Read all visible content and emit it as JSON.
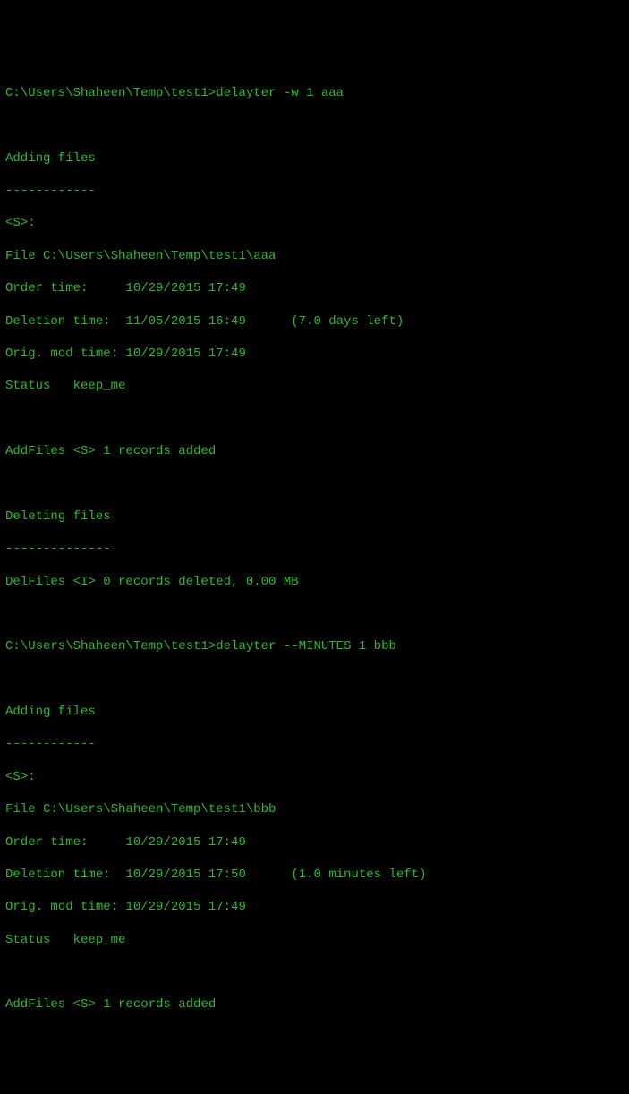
{
  "cmd1": {
    "prompt": "C:\\Users\\Shaheen\\Temp\\test1>",
    "command": "delayter -w 1 aaa"
  },
  "section1": {
    "adding_header": "Adding files",
    "dashes": "------------",
    "marker": "<S>:",
    "file_line": "File C:\\Users\\Shaheen\\Temp\\test1\\aaa",
    "order_time": "Order time:     10/29/2015 17:49",
    "deletion_time": "Deletion time:  11/05/2015 16:49      (7.0 days left)",
    "orig_mod_time": "Orig. mod time: 10/29/2015 17:49",
    "status": "Status   keep_me",
    "addfiles_result": "AddFiles <S> 1 records added",
    "deleting_header": "Deleting files",
    "dashes2": "--------------",
    "delfiles_result": "DelFiles <I> 0 records deleted, 0.00 MB"
  },
  "cmd2": {
    "prompt": "C:\\Users\\Shaheen\\Temp\\test1>",
    "command": "delayter --MINUTES 1 bbb"
  },
  "section2": {
    "adding_header": "Adding files",
    "dashes": "------------",
    "marker": "<S>:",
    "file_line": "File C:\\Users\\Shaheen\\Temp\\test1\\bbb",
    "order_time": "Order time:     10/29/2015 17:49",
    "deletion_time": "Deletion time:  10/29/2015 17:50      (1.0 minutes left)",
    "orig_mod_time": "Orig. mod time: 10/29/2015 17:49",
    "status": "Status   keep_me",
    "addfiles_result": "AddFiles <S> 1 records added"
  }
}
